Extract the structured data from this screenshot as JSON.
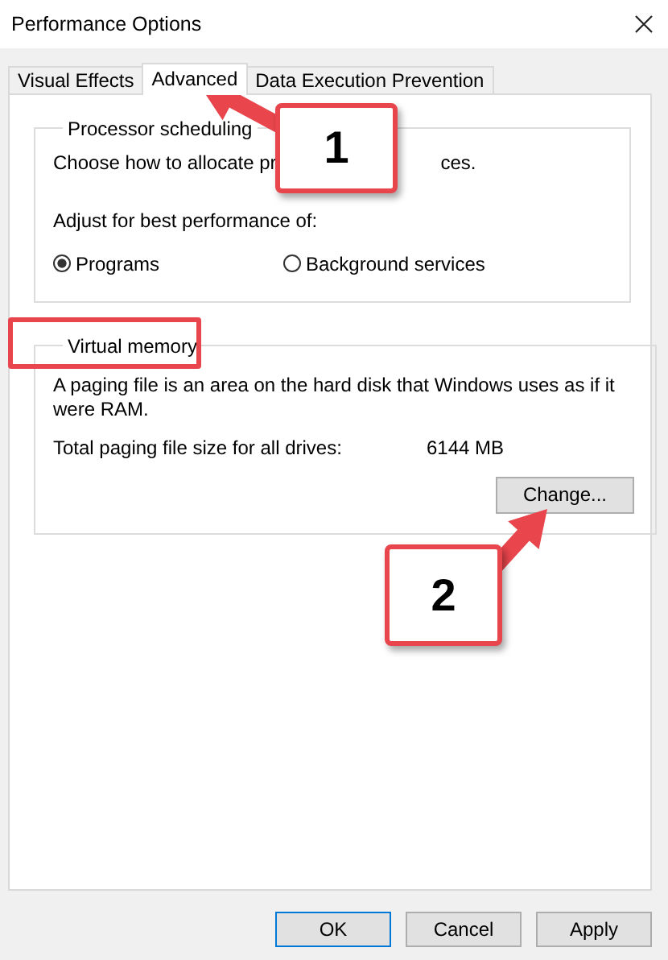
{
  "window": {
    "title": "Performance Options"
  },
  "tabs": [
    {
      "label": "Visual Effects",
      "selected": false
    },
    {
      "label": "Advanced",
      "selected": true
    },
    {
      "label": "Data Execution Prevention",
      "selected": false
    }
  ],
  "processor_scheduling": {
    "title": "Processor scheduling",
    "description_parts": [
      "Choose how to allocate pr",
      "ces."
    ],
    "prompt": "Adjust for best performance of:",
    "options": [
      {
        "label": "Programs",
        "selected": true
      },
      {
        "label": "Background services",
        "selected": false
      }
    ]
  },
  "virtual_memory": {
    "title": "Virtual memory",
    "highlighted": true,
    "description": "A paging file is an area on the hard disk that Windows uses as if it were RAM.",
    "total_label": "Total paging file size for all drives:",
    "total_value": "6144 MB",
    "button": "Change..."
  },
  "buttons": [
    {
      "label": "OK",
      "default": true
    },
    {
      "label": "Cancel",
      "default": false
    },
    {
      "label": "Apply",
      "default": false
    }
  ],
  "callouts": [
    {
      "number": "1"
    },
    {
      "number": "2"
    }
  ]
}
